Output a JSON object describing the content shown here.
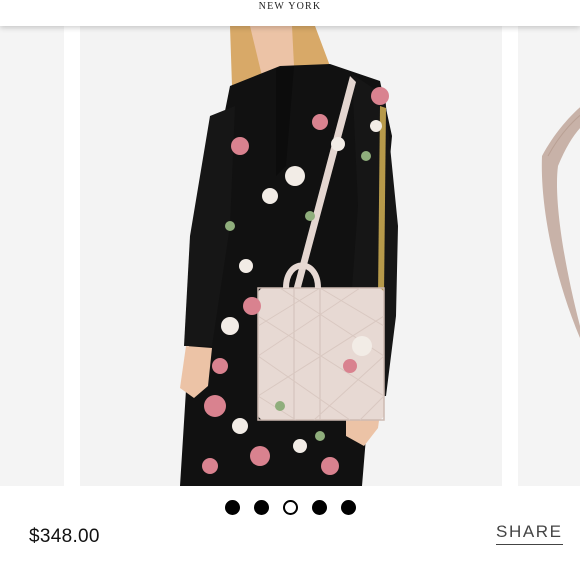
{
  "header": {
    "brand": "NEW YORK"
  },
  "carousel": {
    "slide_count": 5,
    "active_index": 2,
    "dots": [
      {
        "state": "inactive"
      },
      {
        "state": "inactive"
      },
      {
        "state": "active"
      },
      {
        "state": "inactive"
      },
      {
        "state": "inactive"
      }
    ]
  },
  "product": {
    "price": "$348.00"
  },
  "actions": {
    "share_label": "SHARE"
  },
  "colors": {
    "dress": "#111111",
    "bag": "#e7d9d3",
    "skin": "#ecc3a6",
    "hair": "#d8a968",
    "flower_pink": "#d9828f",
    "flower_white": "#f2ece6"
  }
}
